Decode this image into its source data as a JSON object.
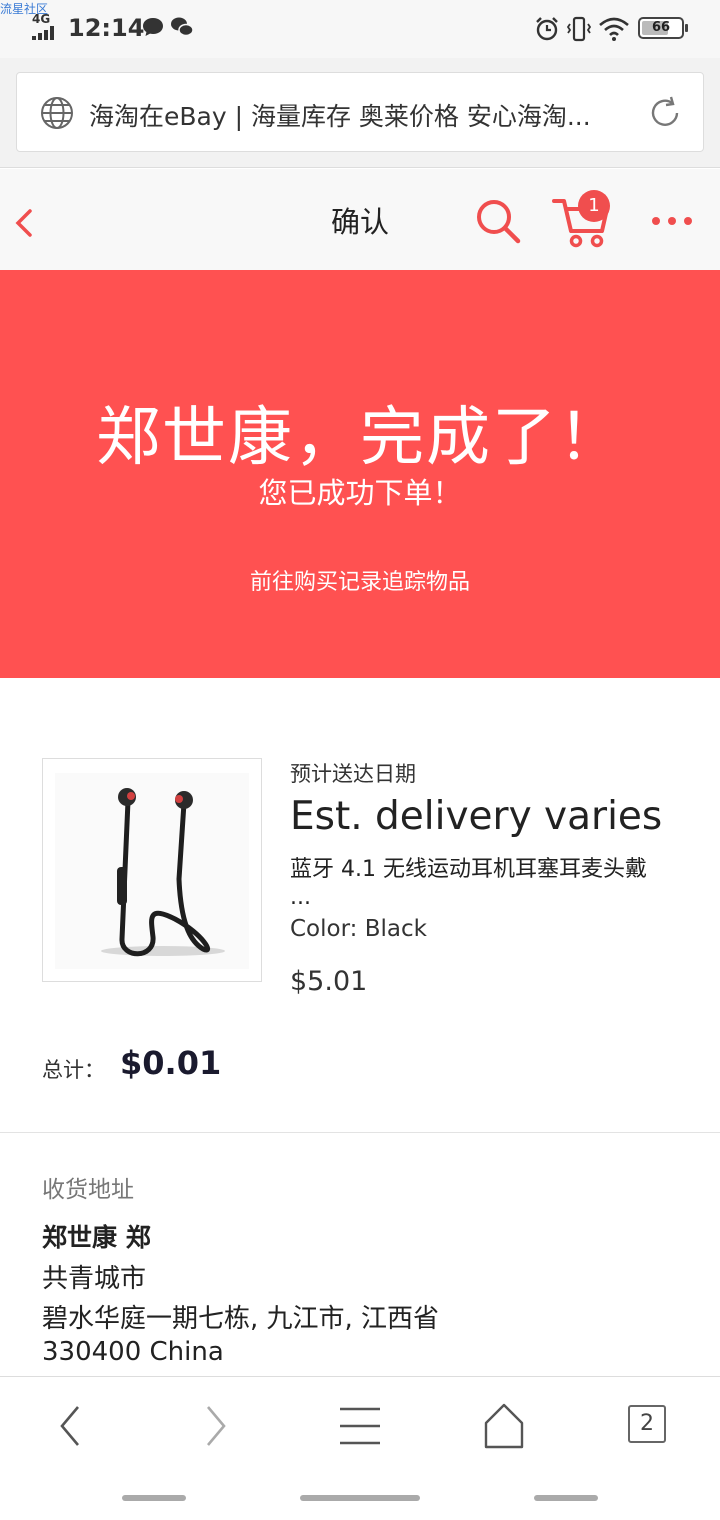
{
  "watermark": "流星社区",
  "status_bar": {
    "network": "4G",
    "time": "12:14",
    "battery": "66"
  },
  "browser": {
    "url_text": "海淘在eBay | 海量库存 奥莱价格 安心海淘...",
    "tabs_count": "2"
  },
  "header": {
    "title": "确认",
    "cart_count": "1"
  },
  "hero": {
    "title": "郑世康，完成了！",
    "subtitle": "您已成功下单！",
    "link": "前往购买记录追踪物品"
  },
  "item": {
    "delivery_label": "预计送达日期",
    "delivery": "Est. delivery varies",
    "name": "蓝牙 4.1 无线运动耳机耳塞耳麦头戴",
    "ellipsis": "...",
    "color": "Color: Black",
    "price": "$5.01"
  },
  "total": {
    "label": "总计：",
    "value": "$0.01"
  },
  "address": {
    "label": "收货地址",
    "name": "郑世康 郑",
    "lines": [
      "共青城市",
      "碧水华庭一期七栋, 九江市, 江西省",
      "330400 China"
    ]
  },
  "colors": {
    "accent": "#ff5151",
    "icon_red": "#f04e4e"
  }
}
